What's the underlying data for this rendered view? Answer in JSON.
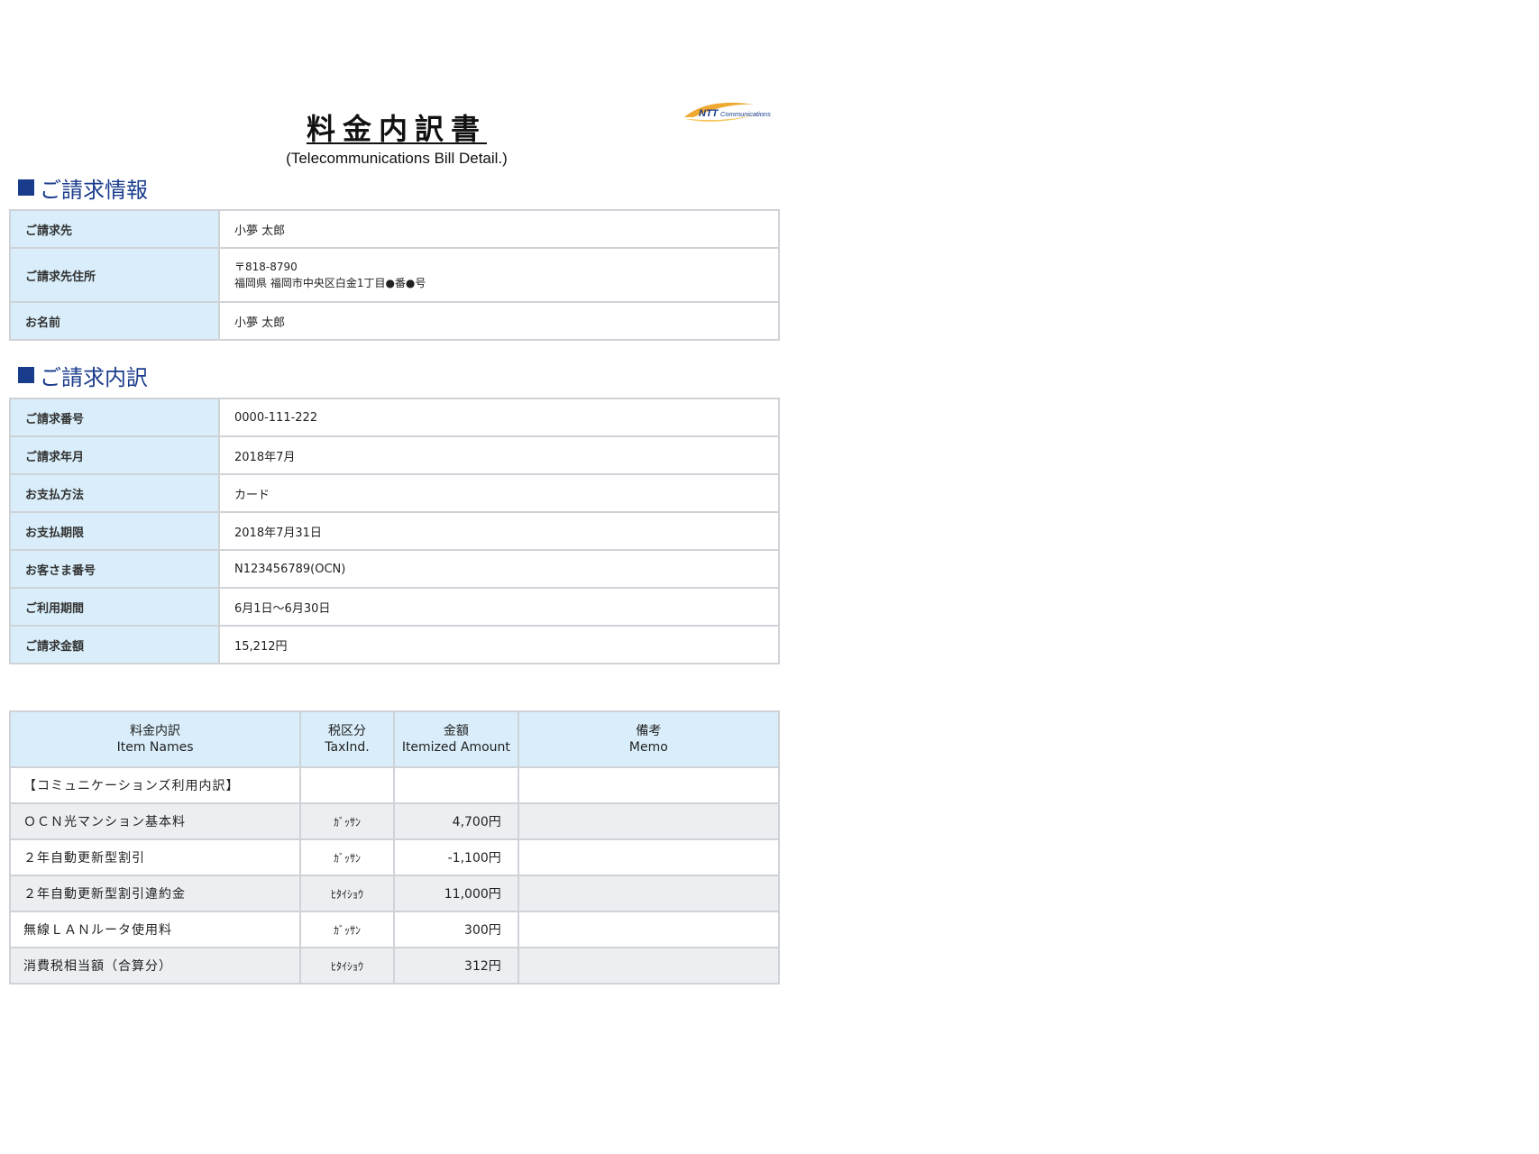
{
  "document": {
    "title_jp": "料金内訳書",
    "title_en": "(Telecommunications Bill Detail.)",
    "logo_text": "NTT Communications"
  },
  "billing_info": {
    "heading": "ご請求情報",
    "rows": [
      {
        "label": "ご請求先",
        "value": "小夢 太郎"
      },
      {
        "label": "ご請求先住所",
        "value_line1": "〒818-8790",
        "value_line2": "福岡県 福岡市中央区白金1丁目●番●号"
      },
      {
        "label": "お名前",
        "value": "小夢 太郎"
      }
    ]
  },
  "billing_detail": {
    "heading": "ご請求内訳",
    "rows": [
      {
        "label": "ご請求番号",
        "value": "0000-111-222"
      },
      {
        "label": "ご請求年月",
        "value": "2018年7月"
      },
      {
        "label": "お支払方法",
        "value": "カード"
      },
      {
        "label": "お支払期限",
        "value": "2018年7月31日"
      },
      {
        "label": "お客さま番号",
        "value": "N123456789(OCN)"
      },
      {
        "label": "ご利用期間",
        "value": "6月1日～6月30日"
      },
      {
        "label": "ご請求金額",
        "value": "15,212円"
      }
    ]
  },
  "items_table": {
    "headers": [
      {
        "jp": "料金内訳",
        "en": "Item Names"
      },
      {
        "jp": "税区分",
        "en": "TaxInd."
      },
      {
        "jp": "金額",
        "en": "Itemized Amount"
      },
      {
        "jp": "備考",
        "en": "Memo"
      }
    ],
    "rows": [
      {
        "item": "【コミュニケーションズ利用内訳】",
        "tax": "",
        "amount": "",
        "memo": ""
      },
      {
        "item": "ＯＣＮ光マンション基本料",
        "tax": "ｶﾞｯｻﾝ",
        "amount": "4,700円",
        "memo": ""
      },
      {
        "item": "２年自動更新型割引",
        "tax": "ｶﾞｯｻﾝ",
        "amount": "-1,100円",
        "memo": ""
      },
      {
        "item": "２年自動更新型割引違約金",
        "tax": "ﾋﾀｲｼｮｳ",
        "amount": "11,000円",
        "memo": ""
      },
      {
        "item": "無線ＬＡＮルータ使用料",
        "tax": "ｶﾞｯｻﾝ",
        "amount": "300円",
        "memo": ""
      },
      {
        "item": "消費税相当額（合算分）",
        "tax": "ﾋﾀｲｼｮｳ",
        "amount": "312円",
        "memo": ""
      }
    ]
  },
  "colors": {
    "accent": "#1a3c8c",
    "label_bg": "#d9eefa",
    "border": "#cfd3d8",
    "shade": "#eceef2"
  }
}
